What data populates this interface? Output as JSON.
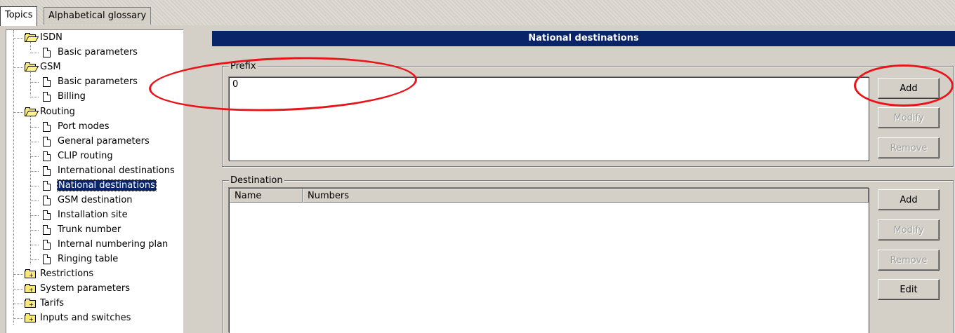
{
  "tabs": {
    "topics": "Topics",
    "glossary": "Alphabetical glossary"
  },
  "tree": {
    "isdn": "ISDN",
    "isdn_basic": "Basic parameters",
    "gsm": "GSM",
    "gsm_basic": "Basic parameters",
    "gsm_billing": "Billing",
    "routing": "Routing",
    "port_modes": "Port modes",
    "general_parameters": "General parameters",
    "clip_routing": "CLIP routing",
    "international_destinations": "International destinations",
    "national_destinations": "National destinations",
    "gsm_destination": "GSM destination",
    "installation_site": "Installation site",
    "trunk_number": "Trunk number",
    "internal_numbering_plan": "Internal numbering plan",
    "ringing_table": "Ringing table",
    "restrictions": "Restrictions",
    "system_parameters": "System parameters",
    "tarifs": "Tarifs",
    "inputs_switches": "Inputs and switches"
  },
  "panel": {
    "title": "National destinations",
    "prefix_label": "Prefix",
    "prefix_value": "0",
    "prefix_buttons": {
      "add": "Add",
      "modify": "Modify",
      "remove": "Remove"
    },
    "destination_label": "Destination",
    "destination_columns": {
      "name": "Name",
      "numbers": "Numbers"
    },
    "destination_buttons": {
      "add": "Add",
      "modify": "Modify",
      "remove": "Remove",
      "edit": "Edit"
    }
  },
  "colors": {
    "header_bg": "#0a246a",
    "annotation": "#e8141a",
    "selection": "#0a246a"
  },
  "icons": {
    "open_folder": "folder-open-icon",
    "closed_folder": "folder-closed-icon",
    "document": "document-icon"
  }
}
